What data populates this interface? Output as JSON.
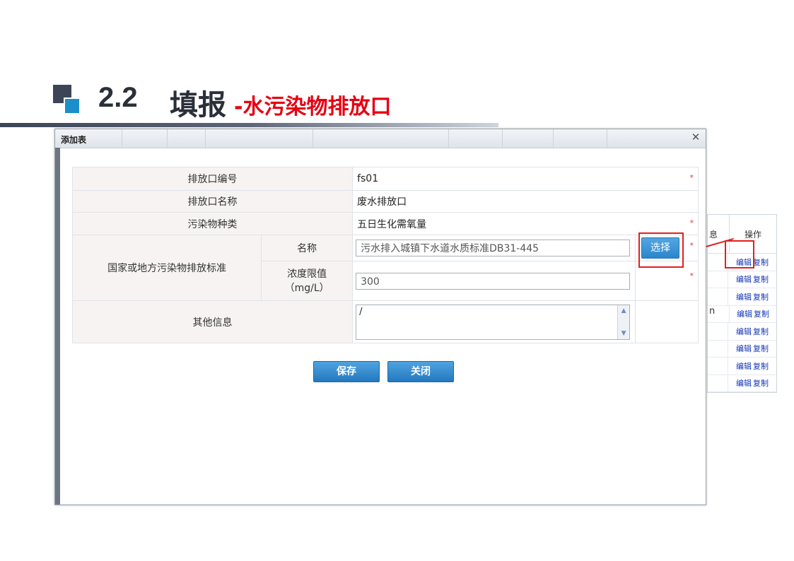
{
  "heading": {
    "number": "2.2",
    "main": "填报",
    "sub": "-水污染物排放口"
  },
  "background_table": {
    "header_partial": "息",
    "header_ops": "操作",
    "row_partial": "n",
    "rows": [
      {
        "edit": "编辑",
        "copy": "复制"
      },
      {
        "edit": "编辑",
        "copy": "复制"
      },
      {
        "edit": "编辑",
        "copy": "复制"
      },
      {
        "edit": "编辑",
        "copy": "复制"
      },
      {
        "edit": "编辑",
        "copy": "复制"
      },
      {
        "edit": "编辑",
        "copy": "复制"
      },
      {
        "edit": "编辑",
        "copy": "复制"
      },
      {
        "edit": "编辑",
        "copy": "复制"
      }
    ]
  },
  "dialog": {
    "title": "添加表",
    "close_icon": "close-icon",
    "fields": {
      "outlet_code": {
        "label": "排放口编号",
        "value": "fs01",
        "required": "*"
      },
      "outlet_name": {
        "label": "排放口名称",
        "value": "废水排放口"
      },
      "pollutant_type": {
        "label": "污染物种类",
        "value": "五日生化需氧量",
        "required": "*"
      },
      "standard": {
        "label": "国家或地方污染物排放标准",
        "name_label": "名称",
        "name_value": "污水排入城镇下水道水质标准DB31-445",
        "select_button": "选择",
        "name_required": "*",
        "limit_label_line1": "浓度限值",
        "limit_label_line2": "（mg/L）",
        "limit_value": "300",
        "limit_required": "*"
      },
      "other_info": {
        "label": "其他信息",
        "value": "/"
      }
    },
    "buttons": {
      "save": "保存",
      "close": "关闭"
    }
  },
  "colors": {
    "accent_blue": "#2b85cc",
    "highlight_red": "#e02020",
    "heading_red": "#e60012",
    "label_bg": "#f7f3f3"
  }
}
